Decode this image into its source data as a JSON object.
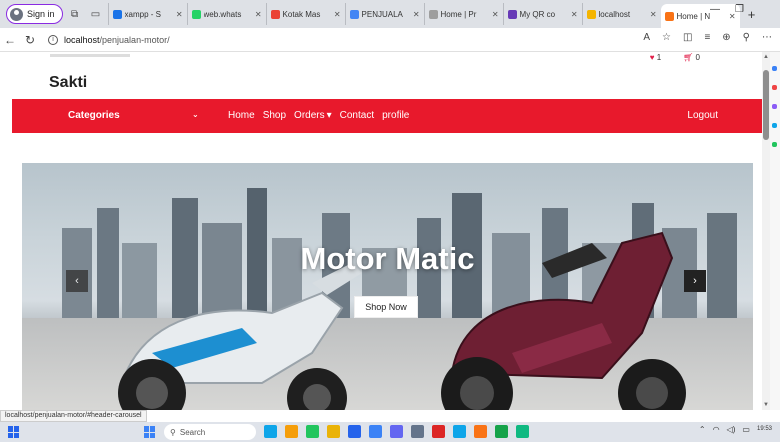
{
  "browser": {
    "signin_label": "Sign in",
    "tabs": [
      {
        "title": "xampp - S",
        "color": "#1a73e8",
        "active": false
      },
      {
        "title": "web.whats",
        "color": "#25d366",
        "active": false
      },
      {
        "title": "Kotak Mas",
        "color": "#ea4335",
        "active": false
      },
      {
        "title": "PENJUALA",
        "color": "#4285f4",
        "active": false
      },
      {
        "title": "Home | Pr",
        "color": "#9e9e9e",
        "active": false
      },
      {
        "title": "My QR co",
        "color": "#673ab7",
        "active": false
      },
      {
        "title": "localhost",
        "color": "#f4b400",
        "active": false
      },
      {
        "title": "Home | N",
        "color": "#f97316",
        "active": true
      }
    ],
    "url_host": "localhost",
    "url_path": "/penjualan-motor/",
    "status_url": "localhost/penjualan-motor/#header-carousel"
  },
  "site": {
    "brand": "Sakti",
    "wishlist_count": "1",
    "cart_count": "0",
    "nav": {
      "categories_label": "Categories",
      "links": [
        "Home",
        "Shop",
        "Orders",
        "Contact",
        "profile"
      ],
      "orders_caret": "▾",
      "logout_label": "Logout"
    },
    "hero": {
      "title": "Motor Matic",
      "button_label": "Shop Now"
    }
  },
  "taskbar": {
    "search_placeholder": "Search",
    "time": "19:53",
    "app_colors": [
      "#0ea5e9",
      "#f59e0b",
      "#22c55e",
      "#eab308",
      "#2563eb",
      "#3b82f6",
      "#6366f1",
      "#64748b",
      "#dc2626",
      "#0ea5e9",
      "#f97316",
      "#16a34a",
      "#10b981"
    ]
  },
  "colors": {
    "accent": "#e8192c"
  }
}
